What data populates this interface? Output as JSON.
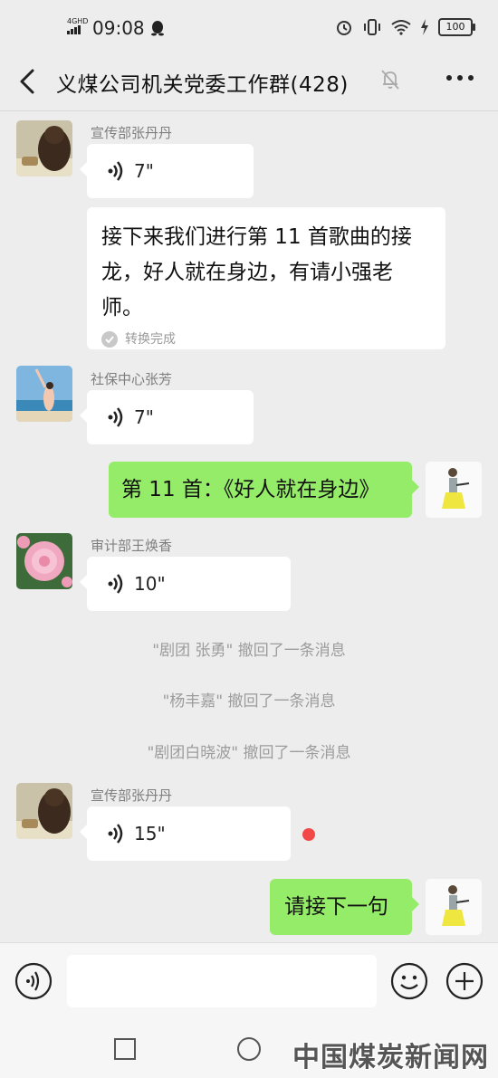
{
  "status_bar": {
    "network": "4GHD",
    "time": "09:08",
    "battery": "100"
  },
  "header": {
    "title": "义煤公司机关党委工作群(428)"
  },
  "messages": {
    "m1": {
      "sender": "宣传部张丹丹",
      "duration": "7\""
    },
    "m2": {
      "text_line1": "接下来我们进行第 11 首歌曲的接",
      "text_line2": "龙，好人就在身边，有请小强老",
      "text_line3": "师。",
      "status": "转换完成"
    },
    "m3": {
      "sender": "社保中心张芳",
      "duration": "7\""
    },
    "m4": {
      "text": "第 11 首：《好人就在身边》"
    },
    "m5": {
      "sender": "审计部王焕香",
      "duration": "10\""
    },
    "sys1": "\"剧团  张勇\" 撤回了一条消息",
    "sys2": "\"杨丰嘉\" 撤回了一条消息",
    "sys3": "\"剧团白晓波\" 撤回了一条消息",
    "m6": {
      "sender": "宣传部张丹丹",
      "duration": "15\""
    },
    "m7": {
      "text": "请接下一句"
    }
  },
  "watermark": "中国煤炭新闻网",
  "colors": {
    "background": "#ededed",
    "self_bubble": "#95ec69",
    "other_bubble": "#ffffff",
    "unread_dot": "#f24848"
  },
  "icons": [
    "back-arrow-icon",
    "mute-bell-icon",
    "more-icon",
    "voice-wave-icon",
    "check-circle-icon",
    "voice-input-icon",
    "emoji-icon",
    "plus-icon",
    "recent-apps-icon",
    "home-icon"
  ]
}
